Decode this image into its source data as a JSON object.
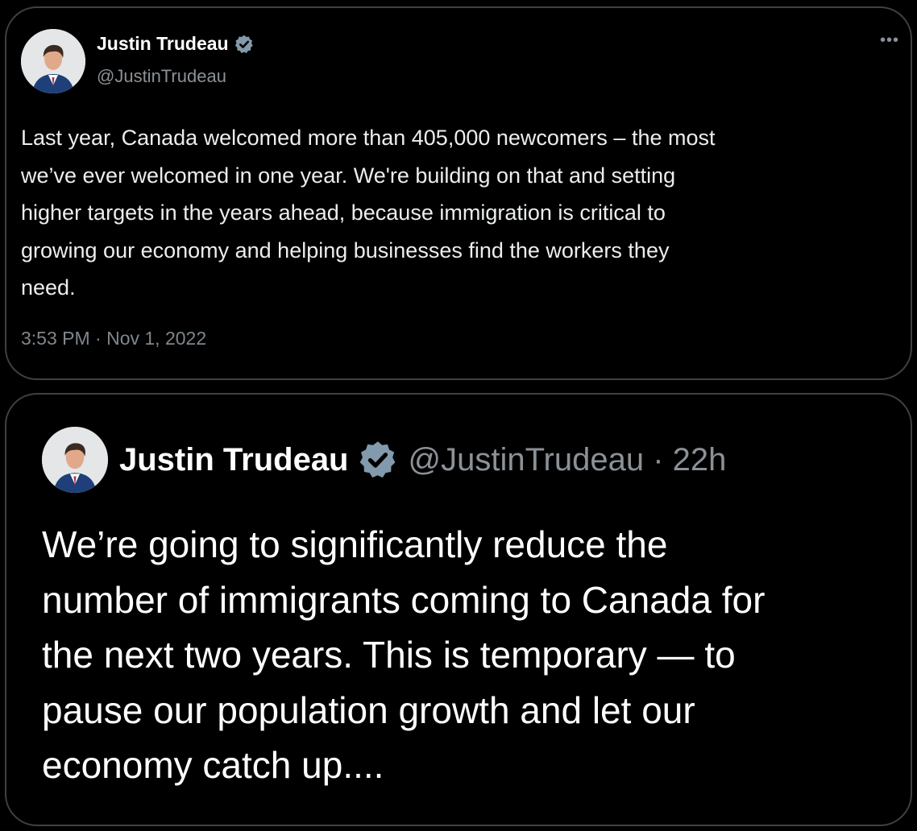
{
  "tweet_original": {
    "author_name": "Justin Trudeau",
    "handle": "@JustinTrudeau",
    "more_icon": "more-horizontal-icon",
    "body_lines": [
      "Last year, Canada welcomed more than 405,000 newcomers – the most",
      "we’ve ever welcomed in one year. We're building on that and setting",
      "higher targets in the years ahead, because immigration is critical to",
      "growing our economy and helping businesses find the workers they",
      "need."
    ],
    "timestamp": "3:53 PM · Nov 1, 2022"
  },
  "tweet_recent": {
    "author_name": "Justin Trudeau",
    "handle_time": "@JustinTrudeau · 22h",
    "body_lines": [
      "We’re going to significantly reduce the",
      "number of immigrants coming to Canada for",
      "the next two years. This is temporary — to",
      "pause our population growth and let our",
      "economy catch up...."
    ]
  },
  "colors": {
    "background": "#000000",
    "verified_badge": "#829aab",
    "card_border": "#3e4144",
    "muted_text": "#8b9196"
  }
}
